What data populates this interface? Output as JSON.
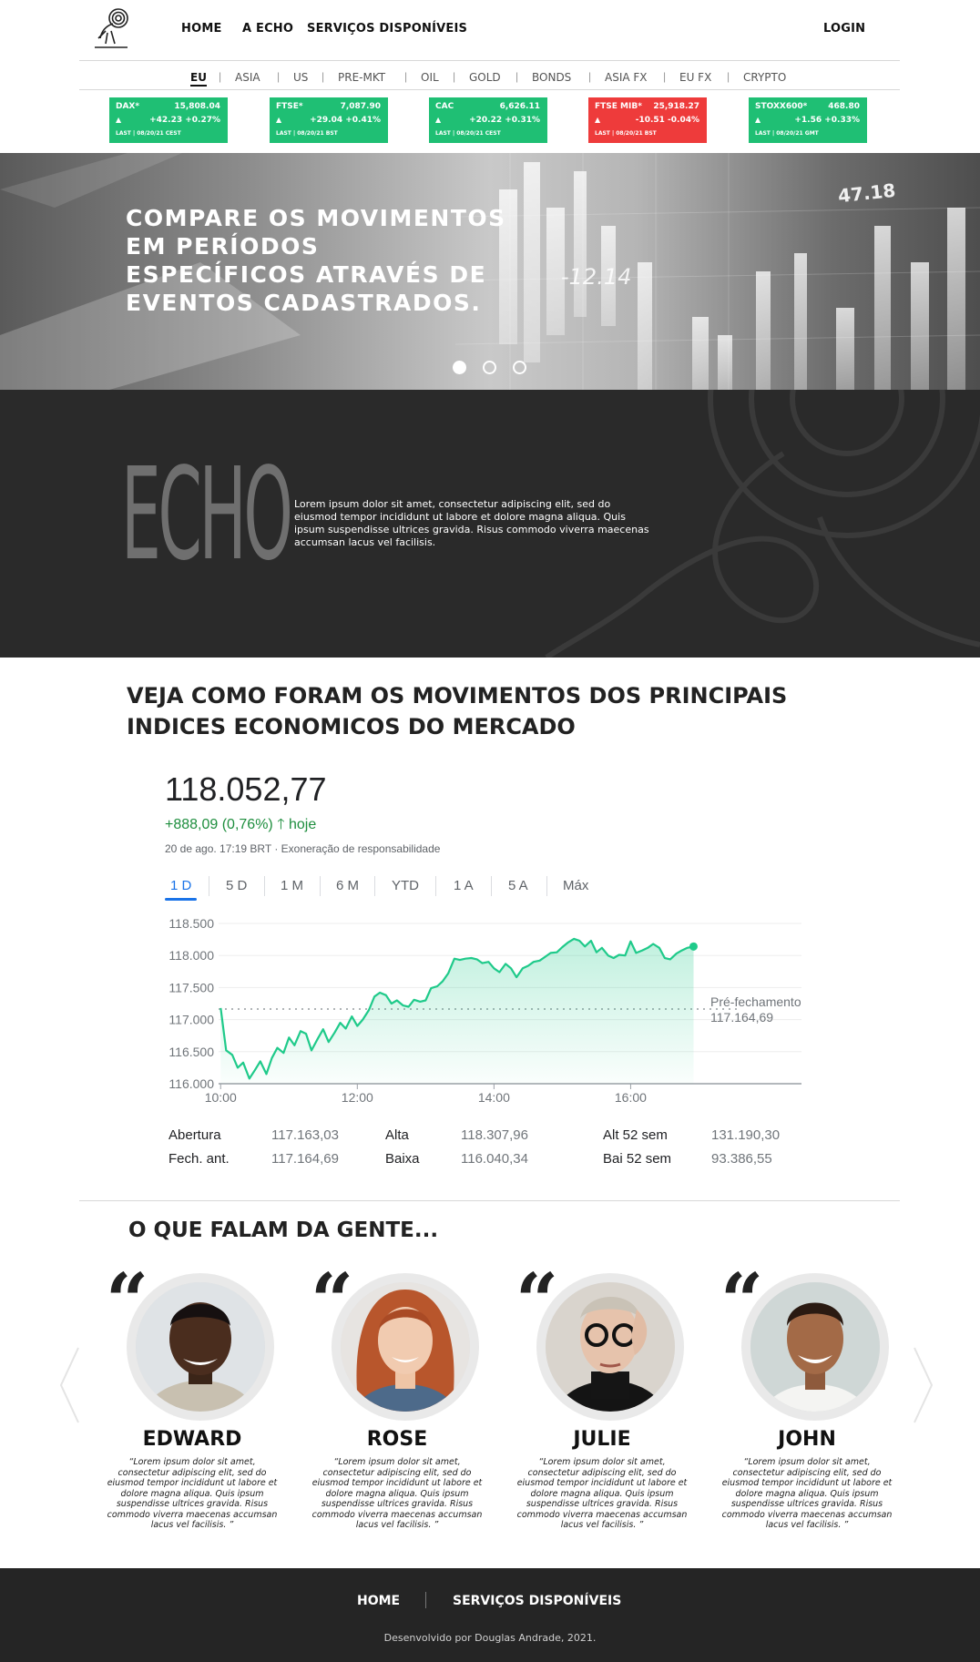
{
  "header": {
    "nav": [
      "HOME",
      "A ECHO",
      "SERVIÇOS DISPONÍVEIS"
    ],
    "login": "LOGIN"
  },
  "markets": {
    "tabs": [
      "EU",
      "ASIA",
      "US",
      "PRE-MKT",
      "OIL",
      "GOLD",
      "BONDS",
      "ASIA FX",
      "EU FX",
      "CRYPTO"
    ],
    "active_tab": "EU",
    "separator": "|"
  },
  "tickers": [
    {
      "name": "DAX*",
      "price": "15,808.04",
      "arrow": "▲",
      "change": "+42.23 +0.27%",
      "last": "LAST | 08/20/21 CEST",
      "direction": "up"
    },
    {
      "name": "FTSE*",
      "price": "7,087.90",
      "arrow": "▲",
      "change": "+29.04 +0.41%",
      "last": "LAST | 08/20/21 BST",
      "direction": "up"
    },
    {
      "name": "CAC",
      "price": "6,626.11",
      "arrow": "▲",
      "change": "+20.22 +0.31%",
      "last": "LAST | 08/20/21 CEST",
      "direction": "up"
    },
    {
      "name": "FTSE MIB*",
      "price": "25,918.27",
      "arrow": "▲",
      "change": "-10.51 -0.04%",
      "last": "LAST | 08/20/21 BST",
      "direction": "down"
    },
    {
      "name": "STOXX600*",
      "price": "468.80",
      "arrow": "▲",
      "change": "+1.56 +0.33%",
      "last": "LAST | 08/20/21 GMT",
      "direction": "up"
    }
  ],
  "hero": {
    "title": "COMPARE OS MOVIMENTOS EM PERÍODOS ESPECÍFICOS ATRAVÉS DE EVENTOS CADASTRADOS.",
    "overlay_number": "-12.14",
    "overlay_tag": "47.18",
    "slide_count": 3,
    "active_slide": 0
  },
  "about": {
    "word": "ECHO",
    "text": "Lorem ipsum dolor sit amet, consectetur adipiscing elit, sed do eiusmod tempor incididunt ut labore et dolore magna aliqua. Quis ipsum suspendisse ultrices gravida. Risus commodo viverra maecenas accumsan lacus vel facilisis."
  },
  "indices": {
    "title": "VEJA COMO FORAM OS MOVIMENTOS DOS PRINCIPAIS INDICES ECONOMICOS DO MERCADO",
    "price": "118.052,77",
    "change": "+888,09 (0,76%)",
    "change_arrow": "🡑",
    "change_period": "hoje",
    "timestamp": "20 de ago. 17:19 BRT · Exoneração de responsabilidade",
    "ranges": [
      "1 D",
      "5 D",
      "1 M",
      "6 M",
      "YTD",
      "1 A",
      "5 A",
      "Máx"
    ],
    "active_range": "1 D",
    "stats": [
      {
        "label": "Abertura",
        "value": "117.163,03"
      },
      {
        "label": "Fech. ant.",
        "value": "117.164,69"
      },
      {
        "label": "Alta",
        "value": "118.307,96"
      },
      {
        "label": "Baixa",
        "value": "116.040,34"
      },
      {
        "label": "Alt 52 sem",
        "value": "131.190,30"
      },
      {
        "label": "Bai 52 sem",
        "value": "93.386,55"
      }
    ]
  },
  "chart_data": {
    "type": "area",
    "x_ticks": [
      "10:00",
      "12:00",
      "14:00",
      "16:00"
    ],
    "y_ticks": [
      "118.500",
      "118.000",
      "117.500",
      "117.000",
      "116.500",
      "116.000"
    ],
    "ylim": [
      116000,
      118500
    ],
    "xlim_hours": [
      9.97,
      18.5
    ],
    "reference_line": {
      "label": "Pré-fechamento",
      "value": 117164.69,
      "value_label": "117.164,69"
    },
    "line_color": "#1fca8a",
    "series": [
      {
        "x": [
          10.0,
          10.08,
          10.17,
          10.25,
          10.33,
          10.42,
          10.5,
          10.58,
          10.67,
          10.75,
          10.83,
          10.92,
          11.0,
          11.08,
          11.17,
          11.25,
          11.33,
          11.42,
          11.5,
          11.58,
          11.67,
          11.75,
          11.83,
          11.92,
          12.0,
          12.08,
          12.17,
          12.25,
          12.33,
          12.42,
          12.5,
          12.58,
          12.67,
          12.75,
          12.83,
          12.92,
          13.0,
          13.08,
          13.17,
          13.25,
          13.33,
          13.42,
          13.5,
          13.58,
          13.67,
          13.75,
          13.83,
          13.92,
          14.0,
          14.08,
          14.17,
          14.25,
          14.33,
          14.42,
          14.5,
          14.58,
          14.67,
          14.75,
          14.83,
          14.92,
          15.0,
          15.08,
          15.17,
          15.25,
          15.33,
          15.42,
          15.5,
          15.58,
          15.67,
          15.75,
          15.83,
          15.92,
          16.0,
          16.08,
          16.17,
          16.25,
          16.33,
          16.42,
          16.5,
          16.58,
          16.67,
          16.75,
          16.83,
          16.92
        ],
        "values": [
          117180,
          116520,
          116450,
          116250,
          116330,
          116080,
          116210,
          116350,
          116150,
          116400,
          116560,
          116480,
          116720,
          116600,
          116820,
          116780,
          116520,
          116700,
          116850,
          116650,
          116800,
          116950,
          116860,
          117050,
          116900,
          117000,
          117150,
          117360,
          117420,
          117380,
          117250,
          117300,
          117220,
          117200,
          117310,
          117280,
          117300,
          117490,
          117520,
          117600,
          117720,
          117950,
          117930,
          117950,
          117960,
          117940,
          117880,
          117900,
          117800,
          117740,
          117870,
          117800,
          117660,
          117800,
          117840,
          117900,
          117920,
          117980,
          118040,
          118050,
          118130,
          118200,
          118260,
          118230,
          118140,
          118230,
          118050,
          118120,
          118000,
          117960,
          118010,
          118000,
          118220,
          118040,
          118080,
          118120,
          118180,
          118120,
          117960,
          117940,
          118030,
          118080,
          118120,
          118140
        ]
      }
    ]
  },
  "testimonials": {
    "title": "O QUE FALAM DA GENTE...",
    "items": [
      {
        "name": "EDWARD",
        "text": "“Lorem ipsum dolor sit amet, consectetur adipiscing elit, sed do eiusmod tempor incididunt ut labore et dolore magna aliqua. Quis ipsum suspendisse ultrices gravida. Risus commodo viverra maecenas accumsan lacus vel facilisis. ”"
      },
      {
        "name": "ROSE",
        "text": "“Lorem ipsum dolor sit amet, consectetur adipiscing elit, sed do eiusmod tempor incididunt ut labore et dolore magna aliqua. Quis ipsum suspendisse ultrices gravida. Risus commodo viverra maecenas accumsan lacus vel facilisis. ”"
      },
      {
        "name": "JULIE",
        "text": "“Lorem ipsum dolor sit amet, consectetur adipiscing elit, sed do eiusmod tempor incididunt ut labore et dolore magna aliqua. Quis ipsum suspendisse ultrices gravida. Risus commodo viverra maecenas accumsan lacus vel facilisis. ”"
      },
      {
        "name": "JOHN",
        "text": "“Lorem ipsum dolor sit amet, consectetur adipiscing elit, sed do eiusmod tempor incididunt ut labore et dolore magna aliqua. Quis ipsum suspendisse ultrices gravida. Risus commodo viverra maecenas accumsan lacus vel facilisis. ”"
      }
    ]
  },
  "footer": {
    "nav": [
      "HOME",
      "SERVIÇOS DISPONÍVEIS"
    ],
    "credit": "Desenvolvido por Douglas Andrade, 2021."
  },
  "colors": {
    "up": "#1fbf74",
    "down": "#ee3b3b",
    "dark_band": "#2a2a2a",
    "footer": "#252525",
    "chart_line": "#1fca8a",
    "range_active": "#1a73e8"
  }
}
